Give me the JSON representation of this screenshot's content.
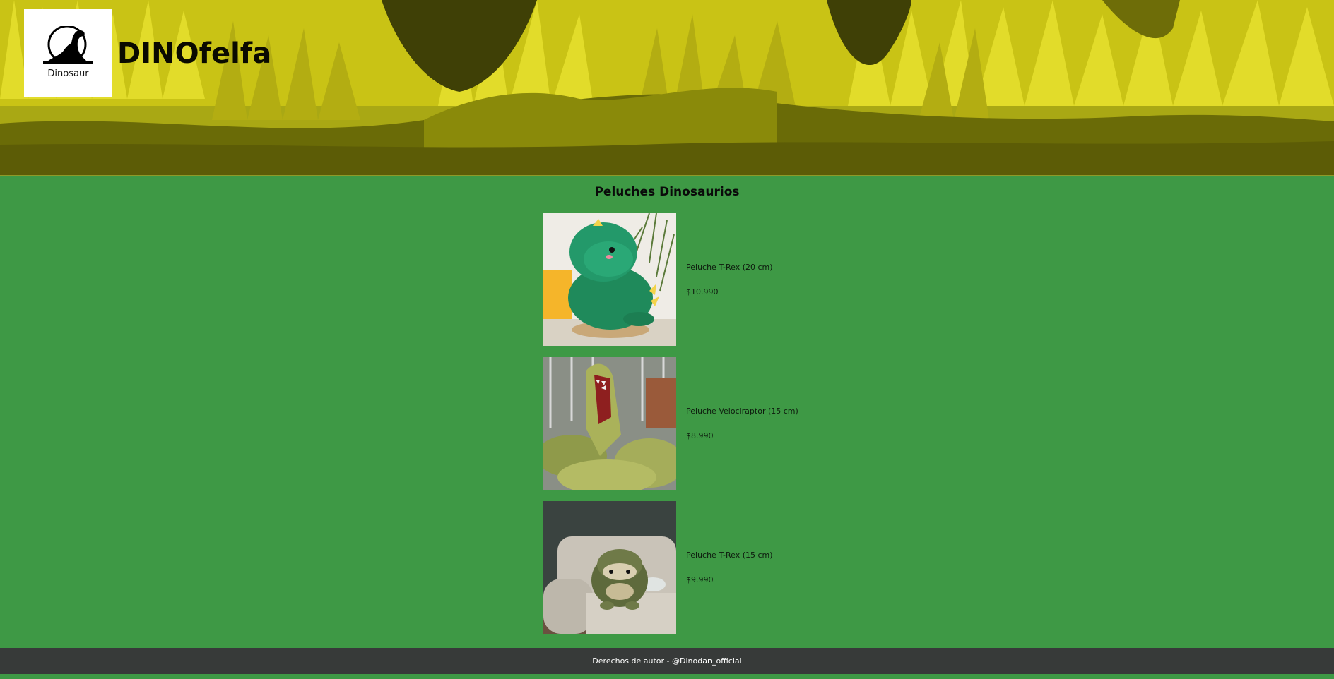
{
  "header": {
    "logo_caption": "Dinosaur",
    "site_title": "DINOfelfa"
  },
  "main": {
    "section_title": "Peluches Dinosaurios",
    "products": [
      {
        "name": "Peluche T-Rex (20 cm)",
        "price": "$10.990"
      },
      {
        "name": "Peluche Velociraptor (15 cm)",
        "price": "$8.990"
      },
      {
        "name": "Peluche T-Rex (15 cm)",
        "price": "$9.990"
      }
    ]
  },
  "footer": {
    "copyright": "Derechos de autor - @Dinodan_official"
  },
  "colors": {
    "page_background": "#3e9945",
    "footer_background": "#373a39",
    "banner_grass_light": "#d6cf1a",
    "banner_grass_dark": "#5c5c06"
  }
}
